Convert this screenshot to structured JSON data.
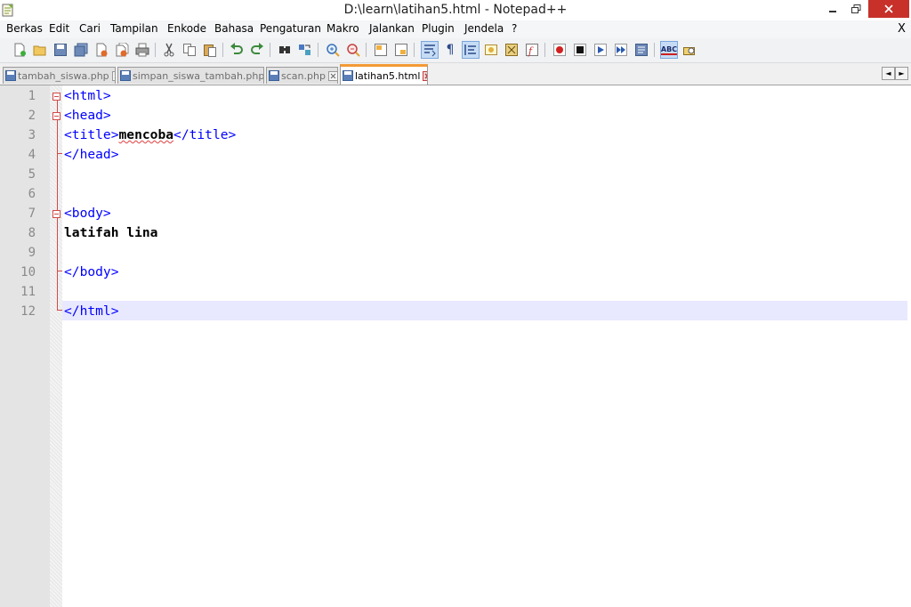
{
  "window": {
    "title": "D:\\learn\\latihan5.html - Notepad++",
    "minimize_glyph": "—",
    "maximize_glyph": "❐",
    "close_glyph": "✕"
  },
  "menu": {
    "items": [
      "Berkas",
      "Edit",
      "Cari",
      "Tampilan",
      "Enkode",
      "Bahasa",
      "Pengaturan",
      "Makro",
      "Jalankan",
      "Plugin",
      "Jendela",
      "?"
    ],
    "close_label": "X"
  },
  "toolbar": {
    "icons": [
      "new-file-icon",
      "open-file-icon",
      "save-icon",
      "save-all-icon",
      "close-icon",
      "close-all-icon",
      "print-icon",
      "cut-icon",
      "copy-icon",
      "paste-icon",
      "undo-icon",
      "redo-icon",
      "find-icon",
      "replace-icon",
      "zoom-in-icon",
      "zoom-out-icon",
      "sync-vertical-icon",
      "sync-horizontal-icon",
      "word-wrap-icon",
      "show-all-chars-icon",
      "indent-guide-icon",
      "user-lang-icon",
      "doc-map-icon",
      "function-list-icon",
      "record-macro-icon",
      "stop-macro-icon",
      "play-macro-icon",
      "run-macro-multiple-icon",
      "save-macro-icon",
      "spell-check-icon",
      "plugin-icon"
    ],
    "spell_label": "ABC"
  },
  "tabs": [
    {
      "label": "tambah_siswa.php",
      "active": false
    },
    {
      "label": "simpan_siswa_tambah.php",
      "active": false
    },
    {
      "label": "scan.php",
      "active": false
    },
    {
      "label": "latihan5.html",
      "active": true
    }
  ],
  "tab_nav": {
    "left": "◄",
    "right": "►"
  },
  "editor": {
    "line_numbers": [
      "1",
      "2",
      "3",
      "4",
      "5",
      "6",
      "7",
      "8",
      "9",
      "10",
      "11",
      "12"
    ],
    "lines": {
      "l1_tag": "<html>",
      "l2_tag": "<head>",
      "l3_open": "<title>",
      "l3_text": "mencoba",
      "l3_close": "</title>",
      "l4_tag": "</head>",
      "l7_tag": "<body>",
      "l8_text": "latifah lina",
      "l10_tag": "</body>",
      "l12_tag": "</html>"
    },
    "current_line": 12
  },
  "colors": {
    "tag": "#0000ff",
    "text": "#000000",
    "line_number": "#8a8a8a",
    "current_line_bg": "#e8e8ff",
    "fold_marker": "#d14a4a",
    "active_tab_accent": "#f39a35"
  }
}
